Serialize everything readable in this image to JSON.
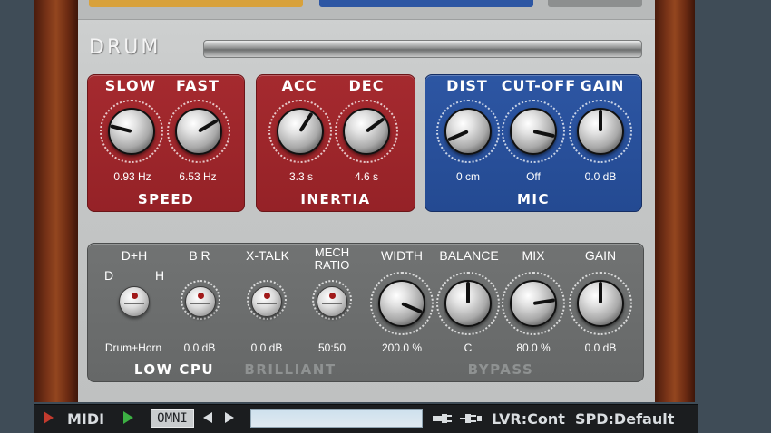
{
  "colors": {
    "red_section": "#a52a2f",
    "blue_section": "#2d56a3",
    "gray_section": "#6d6f6f",
    "panel": "#c8caca",
    "bottom_bar": "#1b1d1f",
    "play_arrow": "#3cb043",
    "red_arrow": "#c23b2e"
  },
  "drum": {
    "title": "DRUM"
  },
  "speed": {
    "name": "SPEED",
    "controls": [
      {
        "label": "SLOW",
        "value": "0.93 Hz",
        "level": 0.22
      },
      {
        "label": "FAST",
        "value": "6.53 Hz",
        "level": 0.72
      }
    ]
  },
  "inertia": {
    "name": "INERTIA",
    "controls": [
      {
        "label": "ACC",
        "value": "3.3 s",
        "level": 0.62
      },
      {
        "label": "DEC",
        "value": "4.6 s",
        "level": 0.7
      }
    ]
  },
  "mic": {
    "name": "MIC",
    "controls": [
      {
        "label": "DIST",
        "value": "0 cm",
        "level": 0.08
      },
      {
        "label": "CUT-OFF",
        "value": "Off",
        "level": 0.88
      },
      {
        "label": "GAIN",
        "value": "0.0 dB",
        "level": 0.5
      }
    ]
  },
  "lower": {
    "dh": {
      "label": "D+H",
      "left": "D",
      "right": "H",
      "value": "Drum+Horn"
    },
    "br": {
      "label": "B R",
      "value": "0.0 dB"
    },
    "xtalk": {
      "label": "X-TALK",
      "value": "0.0 dB"
    },
    "mech": {
      "label_line1": "MECH",
      "label_line2": "RATIO",
      "value": "50:50"
    },
    "width": {
      "label": "WIDTH",
      "value": "200.0 %",
      "level": 0.92
    },
    "balance": {
      "label": "BALANCE",
      "value": "C",
      "level": 0.5
    },
    "mix": {
      "label": "MIX",
      "value": "80.0 %",
      "level": 0.8
    },
    "gain": {
      "label": "GAIN",
      "value": "0.0 dB",
      "level": 0.5
    },
    "low_cpu": "LOW CPU",
    "brilliant": "BRILLIANT",
    "bypass": "BYPASS"
  },
  "bottom": {
    "midi": "MIDI",
    "omni": "OMNI",
    "lvr": "LVR:Cont",
    "spd": "SPD:Default",
    "icons": [
      "play-left-arrow-icon",
      "play-right-arrow-icon",
      "prev-arrow-icon",
      "next-arrow-icon",
      "plug-out-icon",
      "plug-in-icon"
    ]
  }
}
